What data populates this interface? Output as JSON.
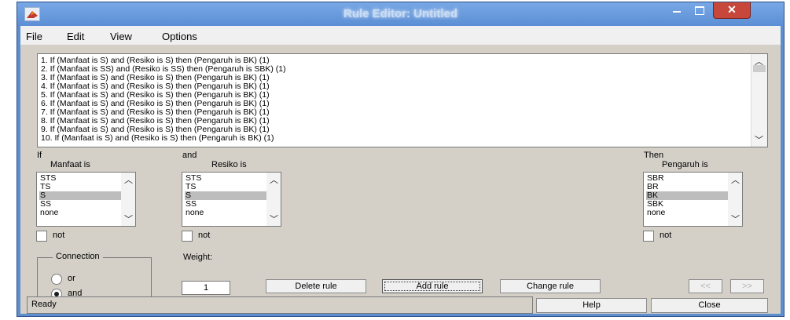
{
  "window": {
    "title": "Rule Editor: Untitled"
  },
  "menu": [
    "File",
    "Edit",
    "View",
    "Options"
  ],
  "rules": [
    "1. If (Manfaat is S) and (Resiko is S) then (Pengaruh is BK) (1)",
    "2. If (Manfaat is SS) and (Resiko is SS) then (Pengaruh is SBK) (1)",
    "3. If (Manfaat is S) and (Resiko is S) then (Pengaruh is BK) (1)",
    "4. If (Manfaat is S) and (Resiko is S) then (Pengaruh is BK) (1)",
    "5. If (Manfaat is S) and (Resiko is S) then (Pengaruh is BK) (1)",
    "6. If (Manfaat is S) and (Resiko is S) then (Pengaruh is BK) (1)",
    "7. If (Manfaat is S) and (Resiko is S) then (Pengaruh is BK) (1)",
    "8. If (Manfaat is S) and (Resiko is S) then (Pengaruh is BK) (1)",
    "9. If (Manfaat is S) and (Resiko is S) then (Pengaruh is BK) (1)",
    "10. If (Manfaat is S) and (Resiko is S) then (Pengaruh is BK) (1)"
  ],
  "antecedent1": {
    "header": "If",
    "label": "Manfaat is",
    "options": [
      "STS",
      "TS",
      "S",
      "SS",
      "none"
    ],
    "selected": "S",
    "not_label": "not"
  },
  "antecedent2": {
    "header": "and",
    "label": "Resiko is",
    "options": [
      "STS",
      "TS",
      "S",
      "SS",
      "none"
    ],
    "selected": "S",
    "not_label": "not"
  },
  "consequent": {
    "header": "Then",
    "label": "Pengaruh is",
    "options": [
      "SBR",
      "BR",
      "BK",
      "SBK",
      "none"
    ],
    "selected": "BK",
    "not_label": "not"
  },
  "connection": {
    "title": "Connection",
    "options": [
      "or",
      "and"
    ],
    "selected": "and"
  },
  "weight": {
    "label": "Weight:",
    "value": "1"
  },
  "buttons": {
    "delete": "Delete rule",
    "add": "Add rule",
    "change": "Change rule",
    "prev": "<<",
    "next": ">>",
    "help": "Help",
    "close": "Close"
  },
  "status": "Ready",
  "colors": {
    "window_frame": "#5d8fd0",
    "close_button": "#c7473a",
    "panel": "#d4d0c8",
    "selection": "#bdbdbd"
  }
}
